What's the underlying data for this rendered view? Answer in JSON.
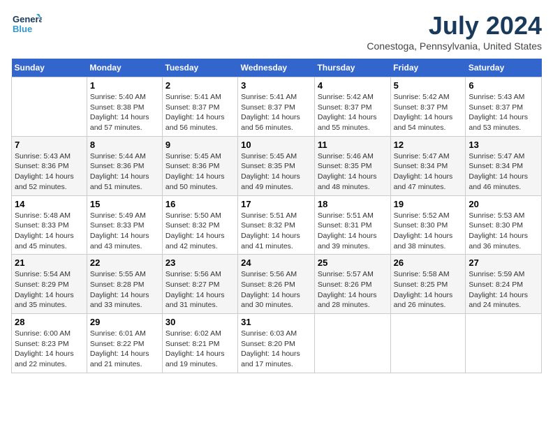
{
  "logo": {
    "line1": "General",
    "line2": "Blue"
  },
  "title": "July 2024",
  "subtitle": "Conestoga, Pennsylvania, United States",
  "days_of_week": [
    "Sunday",
    "Monday",
    "Tuesday",
    "Wednesday",
    "Thursday",
    "Friday",
    "Saturday"
  ],
  "weeks": [
    [
      {
        "day": "",
        "info": ""
      },
      {
        "day": "1",
        "info": "Sunrise: 5:40 AM\nSunset: 8:38 PM\nDaylight: 14 hours\nand 57 minutes."
      },
      {
        "day": "2",
        "info": "Sunrise: 5:41 AM\nSunset: 8:37 PM\nDaylight: 14 hours\nand 56 minutes."
      },
      {
        "day": "3",
        "info": "Sunrise: 5:41 AM\nSunset: 8:37 PM\nDaylight: 14 hours\nand 56 minutes."
      },
      {
        "day": "4",
        "info": "Sunrise: 5:42 AM\nSunset: 8:37 PM\nDaylight: 14 hours\nand 55 minutes."
      },
      {
        "day": "5",
        "info": "Sunrise: 5:42 AM\nSunset: 8:37 PM\nDaylight: 14 hours\nand 54 minutes."
      },
      {
        "day": "6",
        "info": "Sunrise: 5:43 AM\nSunset: 8:37 PM\nDaylight: 14 hours\nand 53 minutes."
      }
    ],
    [
      {
        "day": "7",
        "info": "Sunrise: 5:43 AM\nSunset: 8:36 PM\nDaylight: 14 hours\nand 52 minutes."
      },
      {
        "day": "8",
        "info": "Sunrise: 5:44 AM\nSunset: 8:36 PM\nDaylight: 14 hours\nand 51 minutes."
      },
      {
        "day": "9",
        "info": "Sunrise: 5:45 AM\nSunset: 8:36 PM\nDaylight: 14 hours\nand 50 minutes."
      },
      {
        "day": "10",
        "info": "Sunrise: 5:45 AM\nSunset: 8:35 PM\nDaylight: 14 hours\nand 49 minutes."
      },
      {
        "day": "11",
        "info": "Sunrise: 5:46 AM\nSunset: 8:35 PM\nDaylight: 14 hours\nand 48 minutes."
      },
      {
        "day": "12",
        "info": "Sunrise: 5:47 AM\nSunset: 8:34 PM\nDaylight: 14 hours\nand 47 minutes."
      },
      {
        "day": "13",
        "info": "Sunrise: 5:47 AM\nSunset: 8:34 PM\nDaylight: 14 hours\nand 46 minutes."
      }
    ],
    [
      {
        "day": "14",
        "info": "Sunrise: 5:48 AM\nSunset: 8:33 PM\nDaylight: 14 hours\nand 45 minutes."
      },
      {
        "day": "15",
        "info": "Sunrise: 5:49 AM\nSunset: 8:33 PM\nDaylight: 14 hours\nand 43 minutes."
      },
      {
        "day": "16",
        "info": "Sunrise: 5:50 AM\nSunset: 8:32 PM\nDaylight: 14 hours\nand 42 minutes."
      },
      {
        "day": "17",
        "info": "Sunrise: 5:51 AM\nSunset: 8:32 PM\nDaylight: 14 hours\nand 41 minutes."
      },
      {
        "day": "18",
        "info": "Sunrise: 5:51 AM\nSunset: 8:31 PM\nDaylight: 14 hours\nand 39 minutes."
      },
      {
        "day": "19",
        "info": "Sunrise: 5:52 AM\nSunset: 8:30 PM\nDaylight: 14 hours\nand 38 minutes."
      },
      {
        "day": "20",
        "info": "Sunrise: 5:53 AM\nSunset: 8:30 PM\nDaylight: 14 hours\nand 36 minutes."
      }
    ],
    [
      {
        "day": "21",
        "info": "Sunrise: 5:54 AM\nSunset: 8:29 PM\nDaylight: 14 hours\nand 35 minutes."
      },
      {
        "day": "22",
        "info": "Sunrise: 5:55 AM\nSunset: 8:28 PM\nDaylight: 14 hours\nand 33 minutes."
      },
      {
        "day": "23",
        "info": "Sunrise: 5:56 AM\nSunset: 8:27 PM\nDaylight: 14 hours\nand 31 minutes."
      },
      {
        "day": "24",
        "info": "Sunrise: 5:56 AM\nSunset: 8:26 PM\nDaylight: 14 hours\nand 30 minutes."
      },
      {
        "day": "25",
        "info": "Sunrise: 5:57 AM\nSunset: 8:26 PM\nDaylight: 14 hours\nand 28 minutes."
      },
      {
        "day": "26",
        "info": "Sunrise: 5:58 AM\nSunset: 8:25 PM\nDaylight: 14 hours\nand 26 minutes."
      },
      {
        "day": "27",
        "info": "Sunrise: 5:59 AM\nSunset: 8:24 PM\nDaylight: 14 hours\nand 24 minutes."
      }
    ],
    [
      {
        "day": "28",
        "info": "Sunrise: 6:00 AM\nSunset: 8:23 PM\nDaylight: 14 hours\nand 22 minutes."
      },
      {
        "day": "29",
        "info": "Sunrise: 6:01 AM\nSunset: 8:22 PM\nDaylight: 14 hours\nand 21 minutes."
      },
      {
        "day": "30",
        "info": "Sunrise: 6:02 AM\nSunset: 8:21 PM\nDaylight: 14 hours\nand 19 minutes."
      },
      {
        "day": "31",
        "info": "Sunrise: 6:03 AM\nSunset: 8:20 PM\nDaylight: 14 hours\nand 17 minutes."
      },
      {
        "day": "",
        "info": ""
      },
      {
        "day": "",
        "info": ""
      },
      {
        "day": "",
        "info": ""
      }
    ]
  ]
}
